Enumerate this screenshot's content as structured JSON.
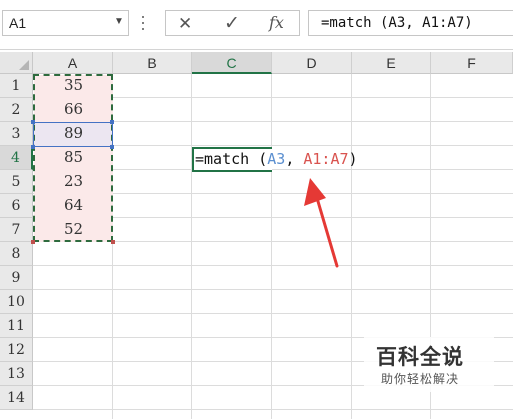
{
  "name_box": {
    "value": "A1"
  },
  "formula_bar": {
    "cancel_icon": "✕",
    "enter_icon": "✓",
    "fx_label": "fx",
    "formula": "=match (A3, A1:A7)"
  },
  "columns": [
    "A",
    "B",
    "C",
    "D",
    "E",
    "F"
  ],
  "selected_column": "C",
  "rows": [
    "1",
    "2",
    "3",
    "4",
    "5",
    "6",
    "7",
    "8",
    "9",
    "10",
    "11",
    "12",
    "13",
    "14"
  ],
  "selected_row": "4",
  "column_a_values": [
    "35",
    "66",
    "89",
    "85",
    "23",
    "64",
    "52"
  ],
  "edit_cell": {
    "prefix": "=match (",
    "ref1": "A3",
    "sep": ", ",
    "ref2": "A1:A7",
    "suffix": ")"
  },
  "colors": {
    "ref1": "#5b8fd0",
    "ref2": "#d9534f",
    "arrow": "#e53935",
    "accent": "#217346"
  },
  "watermark": {
    "title": "百科全说",
    "subtitle": "助你轻松解决"
  }
}
